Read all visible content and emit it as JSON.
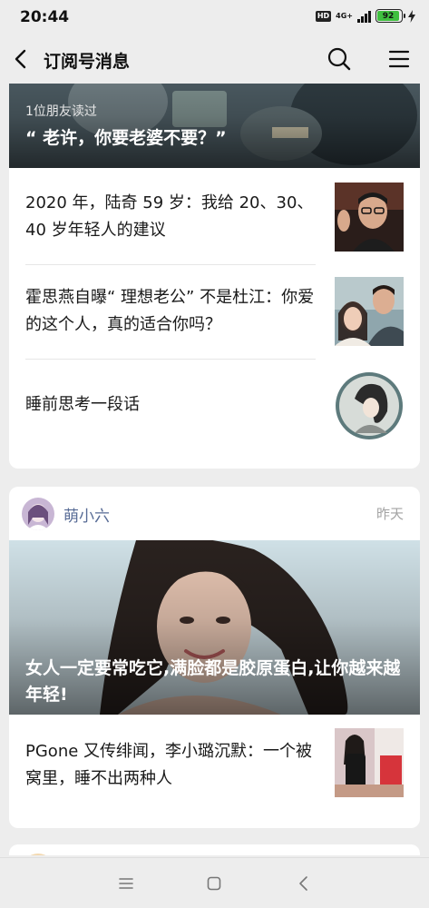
{
  "status_bar": {
    "time": "20:44",
    "hd": "HD",
    "network": "4G+",
    "battery": "92",
    "battery_level": 0.92,
    "icons": [
      "signal-icon",
      "battery-icon",
      "charging-icon"
    ]
  },
  "nav": {
    "title": "订阅号消息",
    "icons": [
      "back-icon",
      "search-icon",
      "menu-icon"
    ]
  },
  "card1": {
    "cover": {
      "friend_read": "1位朋友读过",
      "title": "“ 老许，你要老婆不要？”"
    },
    "articles": [
      {
        "title": "2020 年，陆奇 59 岁：我给 20、30、40 岁年轻人的建议"
      },
      {
        "title": "霍思燕自曝“ 理想老公” 不是杜江：你爱的这个人，真的适合你吗？"
      },
      {
        "title": "睡前思考一段话"
      }
    ]
  },
  "card2": {
    "account": {
      "name": "萌小六",
      "time": "昨天"
    },
    "cover": {
      "title": "女人一定要常吃它,满脸都是胶原蛋白,让你越来越年轻!"
    },
    "articles": [
      {
        "title": "PGone 又传绯闻，李小璐沉默：一个被窝里，睡不出两种人"
      }
    ]
  },
  "bottom_bar": {
    "icons": [
      "recent-apps-icon",
      "home-icon",
      "back-nav-icon"
    ]
  },
  "colors": {
    "background": "#ededed",
    "card": "#ffffff",
    "account_name": "#576b95",
    "muted": "#a3a3a3",
    "battery": "#3fbf3f"
  }
}
